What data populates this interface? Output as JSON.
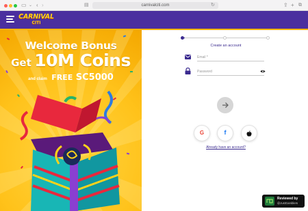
{
  "browser": {
    "url": "carnivalciti.com"
  },
  "header": {
    "logo_line1": "CARNIVAL",
    "logo_line2": "CITI"
  },
  "promo": {
    "title": "Welcome Bonus",
    "get": "Get",
    "coins": "10M Coins",
    "claim": "and claim",
    "free": "FREE",
    "amount": "SC5000"
  },
  "form": {
    "step_label": "Create an account",
    "email_placeholder": "Email *",
    "password_placeholder": "Password",
    "already_link": "Already have an account?"
  },
  "icons": {
    "email": "envelope-icon",
    "password": "lock-icon",
    "visibility": "eye-icon",
    "submit": "arrow-right-icon",
    "google": "google-icon",
    "facebook": "facebook-icon",
    "apple": "apple-icon"
  },
  "badge": {
    "title": "Reviewed by",
    "by": "@JustGamblers"
  },
  "colors": {
    "header": "#4a2f9f",
    "accent": "#3b2b8f",
    "promo_bg": "#ffc21a",
    "stripe": "#f5b400"
  }
}
